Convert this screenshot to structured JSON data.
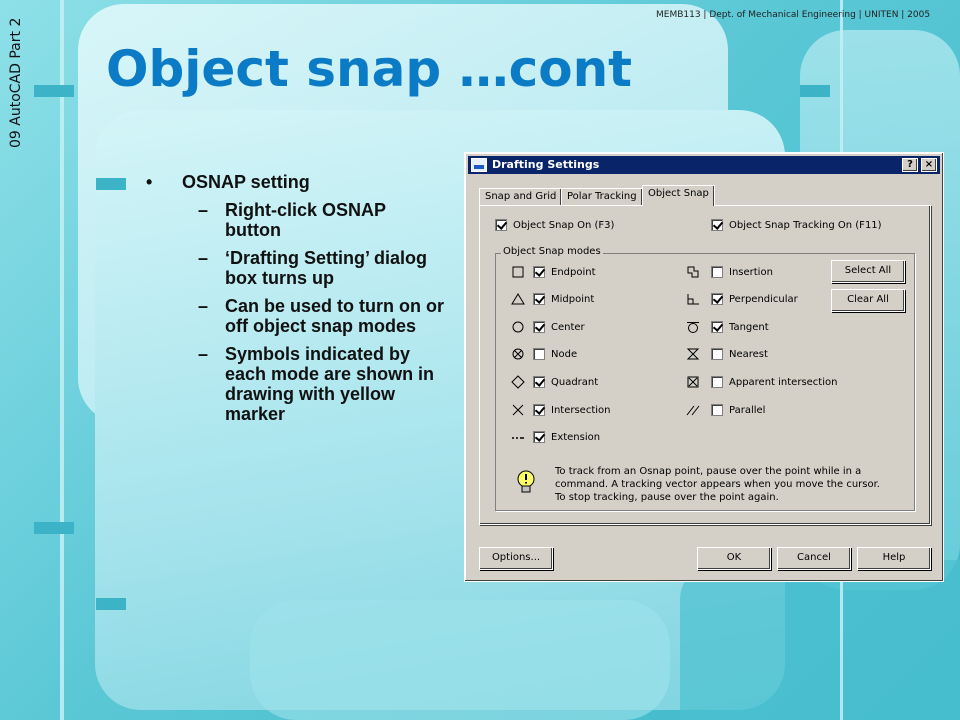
{
  "slide": {
    "side_label": "09 AutoCAD Part 2",
    "header_credit": "MEMB113 | Dept. of Mechanical Engineering | UNITEN | 2005",
    "title": "Object snap …cont",
    "bullet_symbol": "•",
    "dash_symbol": "–",
    "bullet": "OSNAP setting",
    "sub_bullets": [
      "Right-click OSNAP button",
      "‘Drafting Setting’ dialog box turns up",
      "Can be used to turn on or off object snap modes",
      "Symbols indicated by each mode are shown in drawing with yellow marker"
    ]
  },
  "dialog": {
    "title": "Drafting Settings",
    "help_btn": "?",
    "close_btn": "×",
    "tabs": [
      "Snap and Grid",
      "Polar Tracking",
      "Object Snap"
    ],
    "active_tab": "Object Snap",
    "object_snap_on": {
      "label": "Object Snap On (F3)",
      "checked": true
    },
    "tracking_on": {
      "label": "Object Snap Tracking On (F11)",
      "checked": true
    },
    "group_label": "Object Snap modes",
    "left_modes": [
      {
        "label": "Endpoint",
        "checked": true,
        "icon": "endpoint-square-icon"
      },
      {
        "label": "Midpoint",
        "checked": true,
        "icon": "midpoint-triangle-icon"
      },
      {
        "label": "Center",
        "checked": true,
        "icon": "center-circle-icon"
      },
      {
        "label": "Node",
        "checked": false,
        "icon": "node-circle-x-icon"
      },
      {
        "label": "Quadrant",
        "checked": true,
        "icon": "quadrant-diamond-icon"
      },
      {
        "label": "Intersection",
        "checked": true,
        "icon": "intersection-x-icon"
      },
      {
        "label": "Extension",
        "checked": true,
        "icon": "extension-dash-icon"
      }
    ],
    "right_modes": [
      {
        "label": "Insertion",
        "checked": false,
        "icon": "insertion-icon"
      },
      {
        "label": "Perpendicular",
        "checked": true,
        "icon": "perpendicular-icon"
      },
      {
        "label": "Tangent",
        "checked": true,
        "icon": "tangent-icon"
      },
      {
        "label": "Nearest",
        "checked": false,
        "icon": "nearest-hourglass-icon"
      },
      {
        "label": "Apparent intersection",
        "checked": false,
        "icon": "apparent-intersection-icon"
      },
      {
        "label": "Parallel",
        "checked": false,
        "icon": "parallel-icon"
      }
    ],
    "select_all": "Select All",
    "clear_all": "Clear All",
    "tip_text": "To track from an Osnap point, pause over the point while in a command.  A tracking vector appears when you move the cursor. To stop tracking, pause over the point again.",
    "buttons": {
      "options": "Options...",
      "ok": "OK",
      "cancel": "Cancel",
      "help": "Help"
    }
  }
}
